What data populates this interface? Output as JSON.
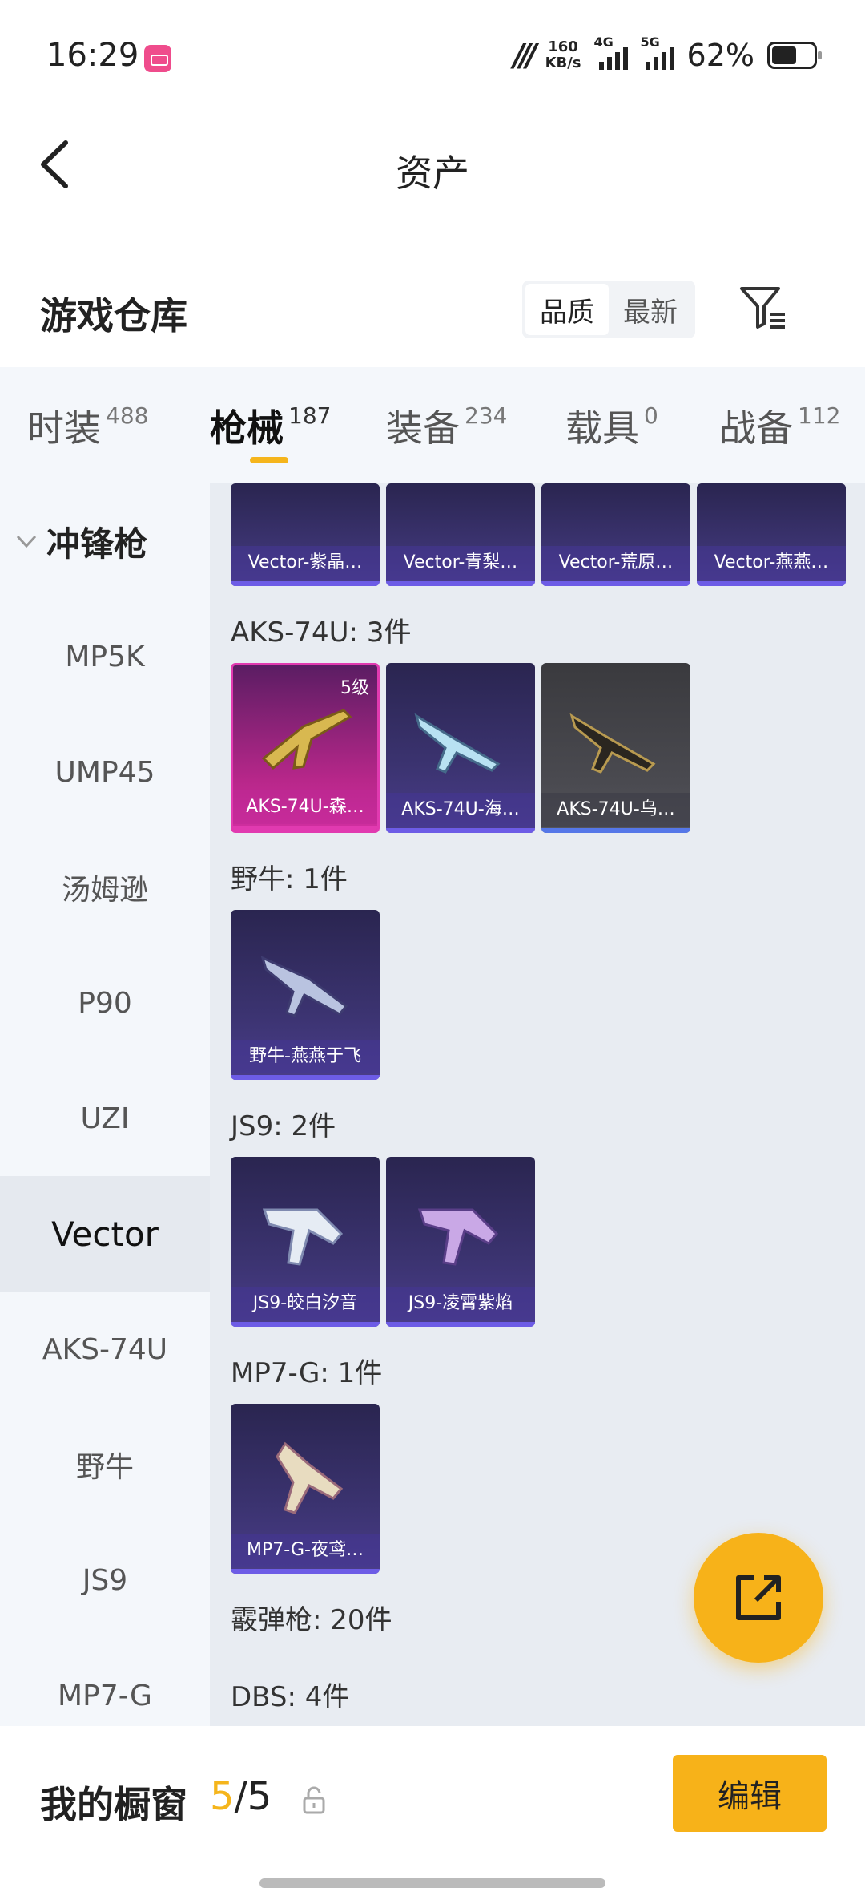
{
  "status_bar": {
    "time": "16:29",
    "net_speed_value": "160",
    "net_speed_unit": "KB/s",
    "sim1": "4G",
    "sim2": "5G",
    "battery": "62%"
  },
  "nav": {
    "title": "资产"
  },
  "warehouse": {
    "title": "游戏仓库",
    "sort_options": [
      "品质",
      "最新"
    ],
    "sort_active": "品质"
  },
  "tabs": [
    {
      "label": "时装",
      "count": "488"
    },
    {
      "label": "枪械",
      "count": "187",
      "active": true
    },
    {
      "label": "装备",
      "count": "234"
    },
    {
      "label": "载具",
      "count": "0"
    },
    {
      "label": "战备",
      "count": "112"
    }
  ],
  "sidebar": {
    "group": "冲锋枪",
    "items": [
      "MP5K",
      "UMP45",
      "汤姆逊",
      "P90",
      "UZI",
      "Vector",
      "AKS-74U",
      "野牛",
      "JS9",
      "MP7-G"
    ],
    "active": "Vector"
  },
  "content": {
    "top_row": [
      "Vector-紫晶…",
      "Vector-青梨…",
      "Vector-荒原…",
      "Vector-燕燕…"
    ],
    "sections": [
      {
        "title": "AKS-74U: 3件",
        "items": [
          {
            "name": "AKS-74U-森…",
            "level": "5级",
            "rarity": "pink"
          },
          {
            "name": "AKS-74U-海…",
            "rarity": "purple"
          },
          {
            "name": "AKS-74U-乌…",
            "rarity": "gray"
          }
        ]
      },
      {
        "title": "野牛: 1件",
        "items": [
          {
            "name": "野牛-燕燕于飞",
            "rarity": "purple"
          }
        ]
      },
      {
        "title": "JS9: 2件",
        "items": [
          {
            "name": "JS9-皎白汐音",
            "rarity": "purple"
          },
          {
            "name": "JS9-凌霄紫焰",
            "rarity": "purple"
          }
        ]
      },
      {
        "title": "MP7-G: 1件",
        "items": [
          {
            "name": "MP7-G-夜鸢…",
            "rarity": "purple"
          }
        ]
      },
      {
        "title": "霰弹枪: 20件",
        "items": []
      },
      {
        "title": "DBS: 4件",
        "items": []
      }
    ]
  },
  "bottom": {
    "showcase_label": "我的橱窗",
    "showcase_current": "5",
    "showcase_sep": "/",
    "showcase_total": "5",
    "edit_label": "编辑"
  },
  "colors": {
    "accent": "#f7b219",
    "pink_rarity": "#e13ab0",
    "purple_rarity": "#6d5ce6",
    "gray_rarity": "#5577e8"
  }
}
